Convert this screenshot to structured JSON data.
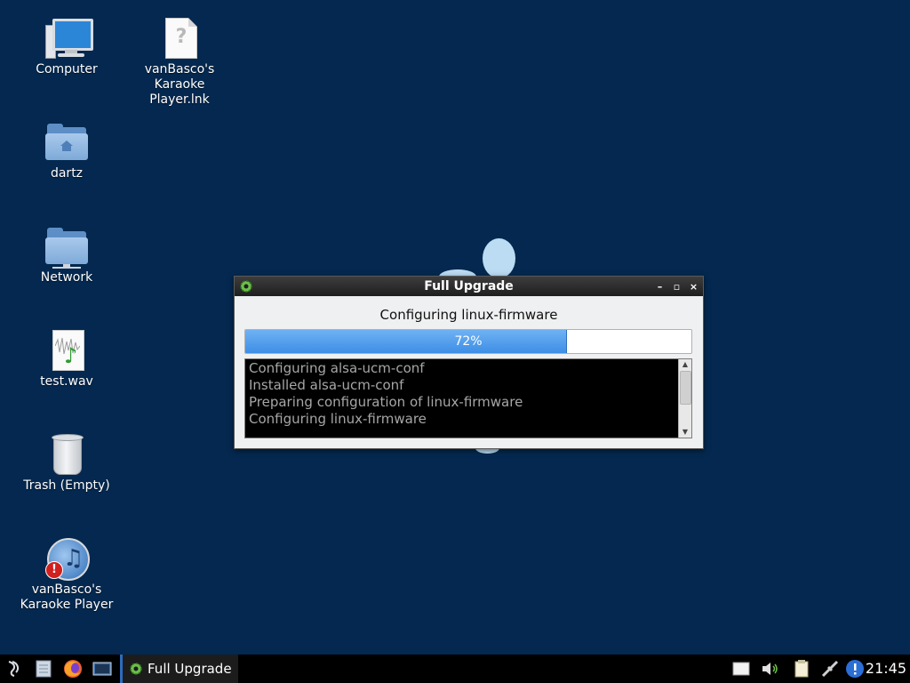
{
  "desktop": {
    "icons": [
      {
        "label": "Computer"
      },
      {
        "label": "vanBasco's Karaoke Player.lnk"
      },
      {
        "label": "dartz"
      },
      {
        "label": "Network"
      },
      {
        "label": "test.wav"
      },
      {
        "label": "Trash (Empty)"
      },
      {
        "label": "vanBasco's Karaoke Player"
      }
    ]
  },
  "dialog": {
    "title": "Full Upgrade",
    "status": "Configuring linux-firmware",
    "progress_text": "72%",
    "progress_fraction": 0.72,
    "log_lines": [
      "Configuring alsa-ucm-conf",
      "Installed alsa-ucm-conf",
      "Preparing configuration of linux-firmware",
      "Configuring linux-firmware"
    ],
    "buttons": {
      "minimize": "–",
      "maximize": "▫",
      "close": "×"
    }
  },
  "taskbar": {
    "task_label": "Full Upgrade",
    "clock": "21:45",
    "launchers": [
      "menu-icon",
      "file-manager-icon",
      "firefox-icon",
      "terminal-icon"
    ],
    "tray": [
      "clipboard-icon",
      "volume-icon",
      "notes-icon",
      "network-icon",
      "update-alert-icon"
    ]
  },
  "colors": {
    "desktop_bg": "#04284f",
    "progress_fill": "#3d8ee6",
    "log_bg": "#000000",
    "log_text": "#a6a6a6"
  }
}
